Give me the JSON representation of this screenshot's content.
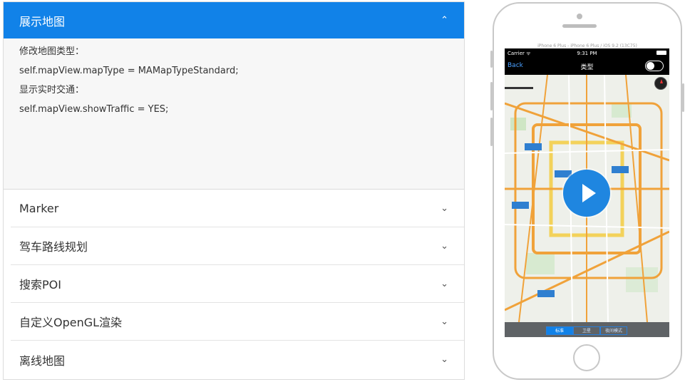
{
  "accordion": {
    "active": {
      "title": "展示地图",
      "lines": [
        "修改地图类型：",
        "self.mapView.mapType = MAMapTypeStandard;",
        "显示实时交通：",
        "self.mapView.showTraffic = YES;"
      ]
    },
    "items": [
      {
        "label": "Marker"
      },
      {
        "label": "驾车路线规划"
      },
      {
        "label": "搜索POI"
      },
      {
        "label": "自定义OpenGL渲染"
      },
      {
        "label": "离线地图"
      }
    ]
  },
  "phone": {
    "simulator_label": "iPhone 6 Plus - iPhone 6 Plus / iOS 9.2 (13C75)",
    "status": {
      "carrier": "Carrier ᯤ",
      "time": "9:31 PM"
    },
    "navbar": {
      "back": "Back",
      "title": "类型"
    },
    "segments": [
      "标准",
      "卫星",
      "夜间模式"
    ],
    "colors": {
      "accent": "#1182e8",
      "road": "#f0a23a",
      "ring": "#f3d25a"
    }
  }
}
